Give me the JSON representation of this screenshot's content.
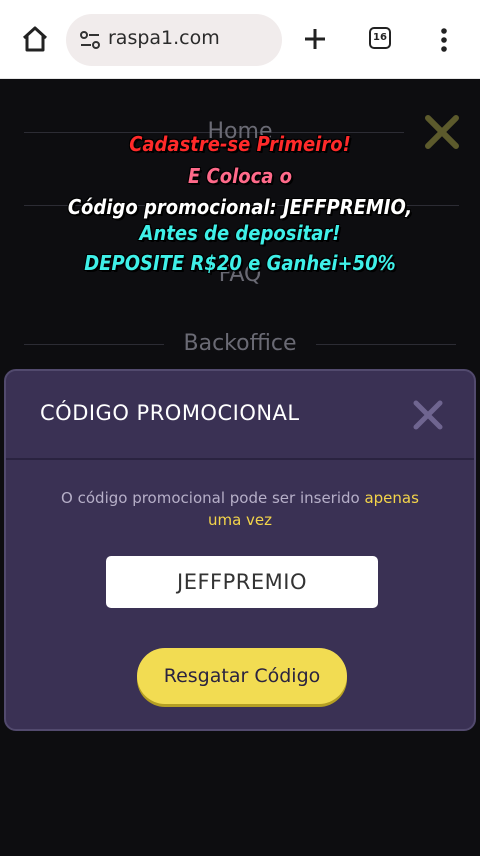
{
  "browser": {
    "url": "raspa1.com",
    "tab_count": "16"
  },
  "nav": {
    "items": [
      "Home",
      "FAQ",
      "Backoffice"
    ]
  },
  "overlay": {
    "lines": [
      {
        "text": "Cadastre-se Primeiro!",
        "color": "#ff2a2a"
      },
      {
        "text": "E Coloca o",
        "color": "#ff6a8a"
      },
      {
        "text": "Código promocional: JEFFPREMIO,",
        "color": "#ffffff"
      },
      {
        "text": "Antes de depositar!",
        "color": "#3ff0e8"
      },
      {
        "text": "DEPOSITE R$20 e Ganhei+50%",
        "color": "#3ff0e8"
      }
    ]
  },
  "modal": {
    "title": "CÓDIGO PROMOCIONAL",
    "note_prefix": "O código promocional pode ser inserido ",
    "note_highlight_1": "apenas",
    "note_highlight_2": "uma vez",
    "code_value": "JEFFPREMIO",
    "button_label": "Resgatar Código"
  },
  "colors": {
    "accent_yellow": "#f2dc52",
    "modal_bg": "#3a3154",
    "close_icon": "#6f6590"
  }
}
